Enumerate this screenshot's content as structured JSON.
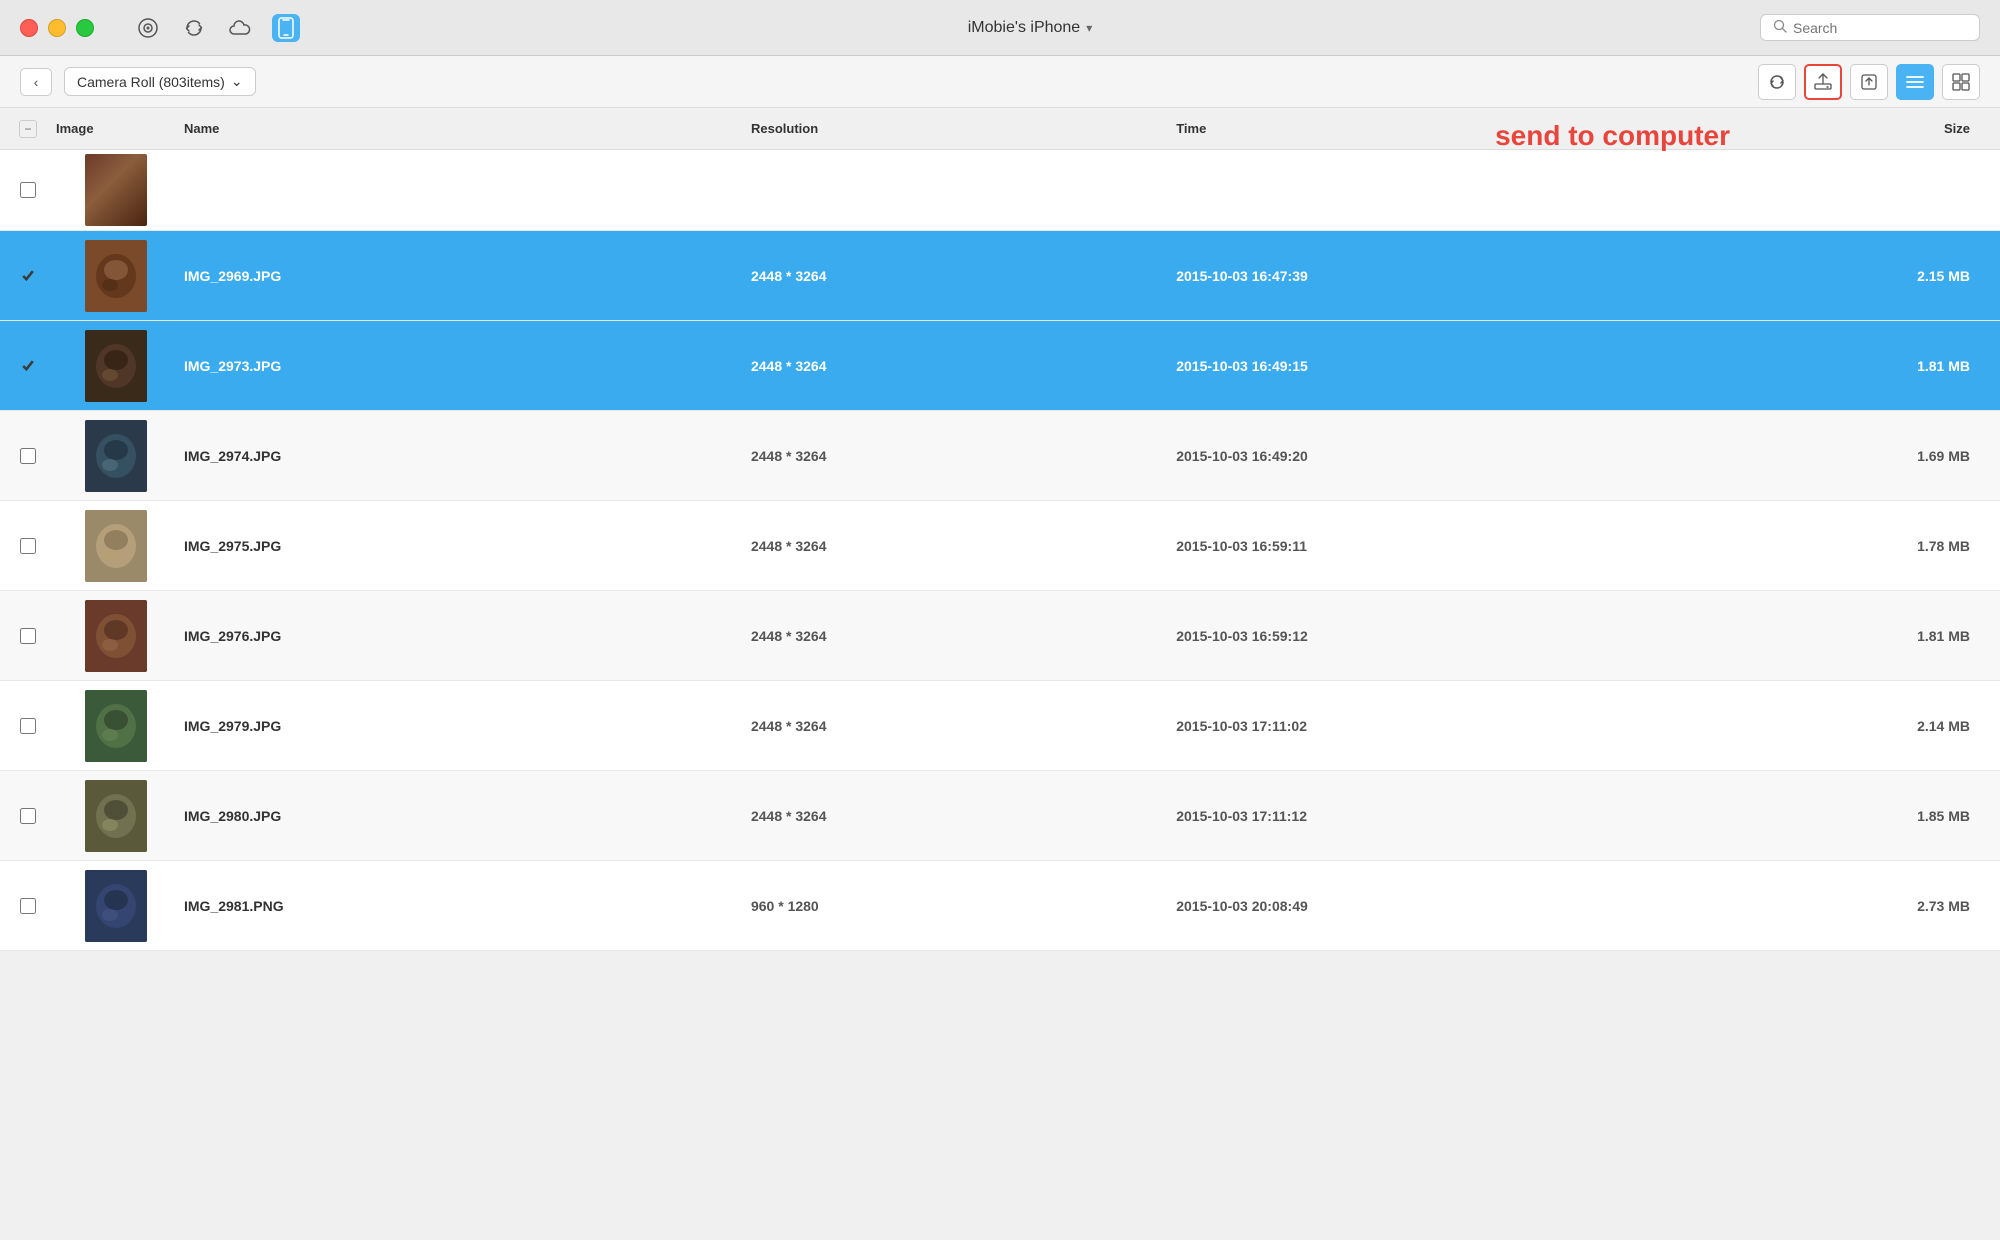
{
  "titleBar": {
    "deviceName": "iMobie's iPhone",
    "chevron": "▾",
    "searchPlaceholder": "Search",
    "icons": [
      {
        "name": "music-icon",
        "symbol": "♩",
        "active": false
      },
      {
        "name": "refresh-icon",
        "symbol": "↻",
        "active": false
      },
      {
        "name": "cloud-icon",
        "symbol": "☁",
        "active": false
      },
      {
        "name": "phone-icon",
        "symbol": "📱",
        "active": true
      }
    ]
  },
  "toolbar": {
    "backLabel": "‹",
    "albumLabel": "Camera Roll (803items)",
    "albumChevron": "⌄",
    "buttons": [
      {
        "name": "refresh-toolbar-btn",
        "symbol": "↻",
        "highlighted": false
      },
      {
        "name": "send-to-computer-btn",
        "symbol": "⬆",
        "highlighted": true
      },
      {
        "name": "export-btn",
        "symbol": "⬆",
        "highlighted": false
      },
      {
        "name": "list-view-btn",
        "symbol": "≡",
        "highlighted": false,
        "active": true
      },
      {
        "name": "grid-view-btn",
        "symbol": "⊞",
        "highlighted": false
      }
    ]
  },
  "tableHeader": {
    "checkLabel": "",
    "imageLabel": "Image",
    "nameLabel": "Name",
    "resolutionLabel": "Resolution",
    "timeLabel": "Time",
    "sizeLabel": "Size"
  },
  "annotation": {
    "text": "send to computer",
    "color": "#e8453c"
  },
  "rows": [
    {
      "id": "row-partial",
      "selected": false,
      "checked": false,
      "thumbClass": "thumb-1",
      "name": "",
      "resolution": "",
      "time": "",
      "size": "",
      "partial": true
    },
    {
      "id": "row-2969",
      "selected": true,
      "checked": true,
      "thumbClass": "thumb-1",
      "name": "IMG_2969.JPG",
      "resolution": "2448 * 3264",
      "time": "2015-10-03 16:47:39",
      "size": "2.15 MB",
      "partial": false
    },
    {
      "id": "row-2973",
      "selected": true,
      "checked": true,
      "thumbClass": "thumb-2",
      "name": "IMG_2973.JPG",
      "resolution": "2448 * 3264",
      "time": "2015-10-03 16:49:15",
      "size": "1.81 MB",
      "partial": false
    },
    {
      "id": "row-2974",
      "selected": false,
      "checked": false,
      "thumbClass": "thumb-3",
      "name": "IMG_2974.JPG",
      "resolution": "2448 * 3264",
      "time": "2015-10-03 16:49:20",
      "size": "1.69 MB",
      "partial": false
    },
    {
      "id": "row-2975",
      "selected": false,
      "checked": false,
      "thumbClass": "thumb-4",
      "name": "IMG_2975.JPG",
      "resolution": "2448 * 3264",
      "time": "2015-10-03 16:59:11",
      "size": "1.78 MB",
      "partial": false
    },
    {
      "id": "row-2976",
      "selected": false,
      "checked": false,
      "thumbClass": "thumb-5",
      "name": "IMG_2976.JPG",
      "resolution": "2448 * 3264",
      "time": "2015-10-03 16:59:12",
      "size": "1.81 MB",
      "partial": false
    },
    {
      "id": "row-2979",
      "selected": false,
      "checked": false,
      "thumbClass": "thumb-6",
      "name": "IMG_2979.JPG",
      "resolution": "2448 * 3264",
      "time": "2015-10-03 17:11:02",
      "size": "2.14 MB",
      "partial": false
    },
    {
      "id": "row-2980",
      "selected": false,
      "checked": false,
      "thumbClass": "thumb-7",
      "name": "IMG_2980.JPG",
      "resolution": "2448 * 3264",
      "time": "2015-10-03 17:11:12",
      "size": "1.85 MB",
      "partial": false
    },
    {
      "id": "row-2981",
      "selected": false,
      "checked": false,
      "thumbClass": "thumb-8",
      "name": "IMG_2981.PNG",
      "resolution": "960 * 1280",
      "time": "2015-10-03 20:08:49",
      "size": "2.73 MB",
      "partial": false
    }
  ]
}
